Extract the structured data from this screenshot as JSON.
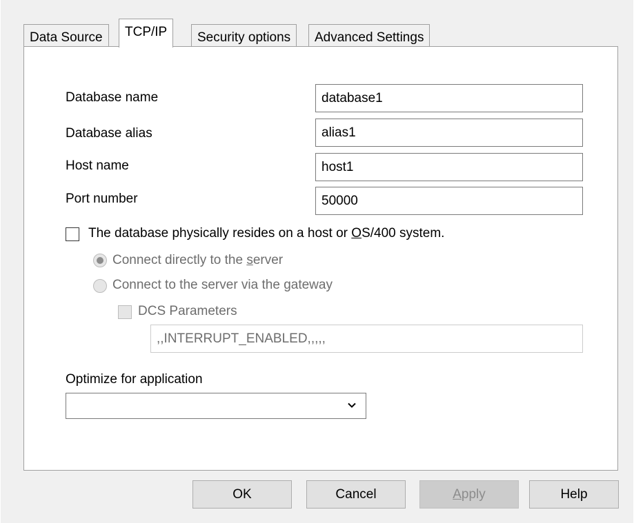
{
  "tabs": [
    {
      "label": "Data Source",
      "active": false
    },
    {
      "label": "TCP/IP",
      "active": true
    },
    {
      "label": "Security options",
      "active": false
    },
    {
      "label": "Advanced Settings",
      "active": false
    }
  ],
  "fields": {
    "database_name": {
      "label": "Database name",
      "value": "database1"
    },
    "database_alias": {
      "label": "Database alias",
      "value": "alias1"
    },
    "host_name": {
      "label": "Host name",
      "value": "host1"
    },
    "port_number": {
      "label": "Port number",
      "value": "50000"
    }
  },
  "host_checkbox": {
    "label_before": "The database physically resides on a host or ",
    "label_mnemonic": "O",
    "label_after": "S/400 system.",
    "checked": false
  },
  "connect_options": [
    {
      "label_before": "Connect directly to the ",
      "mnemonic": "s",
      "label_after": "erver",
      "selected": true
    },
    {
      "label_before": "Connect to the server via the ",
      "mnemonic": "g",
      "label_after": "ateway",
      "selected": false
    }
  ],
  "dcs": {
    "label": "DCS Parameters",
    "checked": false,
    "value": ",,INTERRUPT_ENABLED,,,,,"
  },
  "optimize": {
    "label": "Optimize for application",
    "selected": ""
  },
  "buttons": {
    "ok": "OK",
    "cancel": "Cancel",
    "apply_mnemonic": "A",
    "apply_rest": "pply",
    "help": "Help"
  },
  "icons": {
    "dropdown": "chevron-down-icon"
  },
  "colors": {
    "dialog_bg": "#f0f0f0",
    "panel_bg": "#ffffff",
    "disabled_text": "#6d6d6d",
    "focus_border": "#0078d7"
  }
}
